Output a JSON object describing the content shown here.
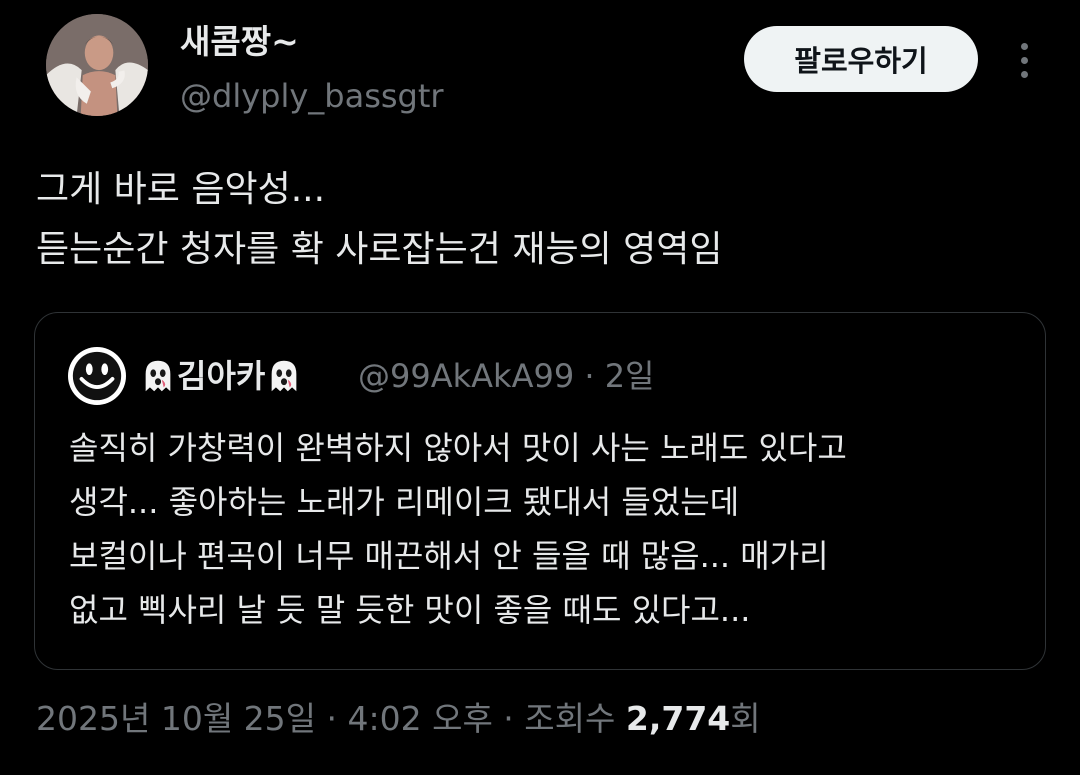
{
  "author": {
    "display_name": "새콤짱~",
    "handle": "@dlyply_bassgtr"
  },
  "follow_label": "팔로우하기",
  "tweet_text": {
    "line1": "그게 바로 음악성...",
    "line2": "듣는순간 청자를 확 사로잡는건 재능의 영역임"
  },
  "quote": {
    "display_name": "김아카",
    "name_emoji": "ghost-icon",
    "handle": "@99AkAkA99",
    "separator": "·",
    "time": "2일",
    "lines": [
      "솔직히 가창력이 완벽하지 않아서 맛이 사는 노래도 있다고",
      "생각... 좋아하는 노래가 리메이크 됐대서 들었는데",
      "보컬이나 편곡이 너무 매끈해서 안 들을 때 많음... 매가리",
      "없고 삑사리 날 듯 말 듯한 맛이 좋을 때도 있다고..."
    ]
  },
  "meta": {
    "datetime": "2025년 10월 25일 · 4:02 오후 ·",
    "views_label_pre": "조회수",
    "views_count": "2,774",
    "views_label_post": "회"
  },
  "colors": {
    "background": "#000000",
    "text_primary": "#e7e9ea",
    "text_secondary": "#71767b",
    "border": "#2f3336",
    "button_bg": "#eff3f4"
  }
}
